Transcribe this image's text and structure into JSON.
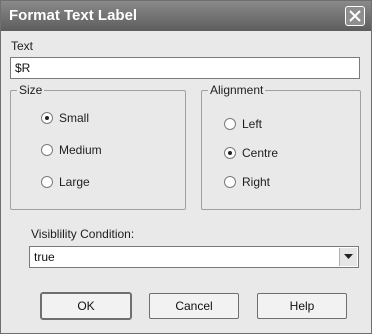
{
  "dialog": {
    "title": "Format Text Label",
    "close_icon": "close-icon"
  },
  "text_section": {
    "label": "Text",
    "value": "$R"
  },
  "size_group": {
    "title": "Size",
    "options": [
      {
        "label": "Small",
        "selected": true
      },
      {
        "label": "Medium",
        "selected": false
      },
      {
        "label": "Large",
        "selected": false
      }
    ]
  },
  "alignment_group": {
    "title": "Alignment",
    "options": [
      {
        "label": "Left",
        "selected": false
      },
      {
        "label": "Centre",
        "selected": true
      },
      {
        "label": "Right",
        "selected": false
      }
    ]
  },
  "visibility": {
    "label": "Visiblility Condition:",
    "value": "true"
  },
  "buttons": {
    "ok": "OK",
    "cancel": "Cancel",
    "help": "Help"
  }
}
